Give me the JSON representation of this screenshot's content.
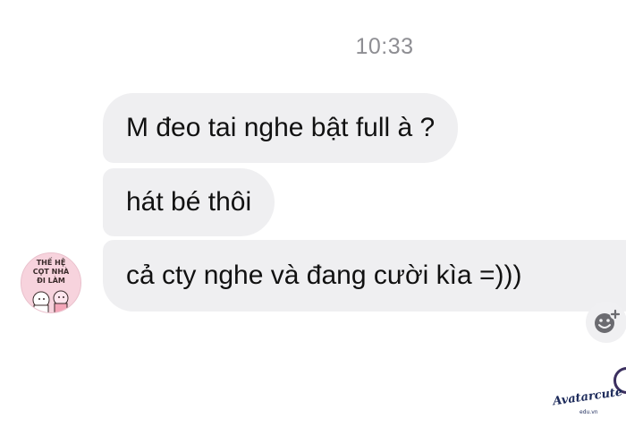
{
  "conversation": {
    "timestamp": "10:33",
    "messages": [
      {
        "text": "M đeo tai nghe bật full à ?"
      },
      {
        "text": "hát bé thôi"
      },
      {
        "text": "cả cty nghe và đang cười kìa =)))"
      }
    ]
  },
  "avatar": {
    "line1": "THẾ HỆ",
    "line2": "CỌT NHÀ",
    "line3": "ĐI LÀM"
  },
  "watermark": {
    "brand": "Avatarcute",
    "domain": "edu.vn"
  },
  "icons": {
    "add_reaction": "add-reaction-icon"
  },
  "colors": {
    "bubble": "#efeff1",
    "timestamp": "#8e8e93",
    "text": "#111111"
  }
}
